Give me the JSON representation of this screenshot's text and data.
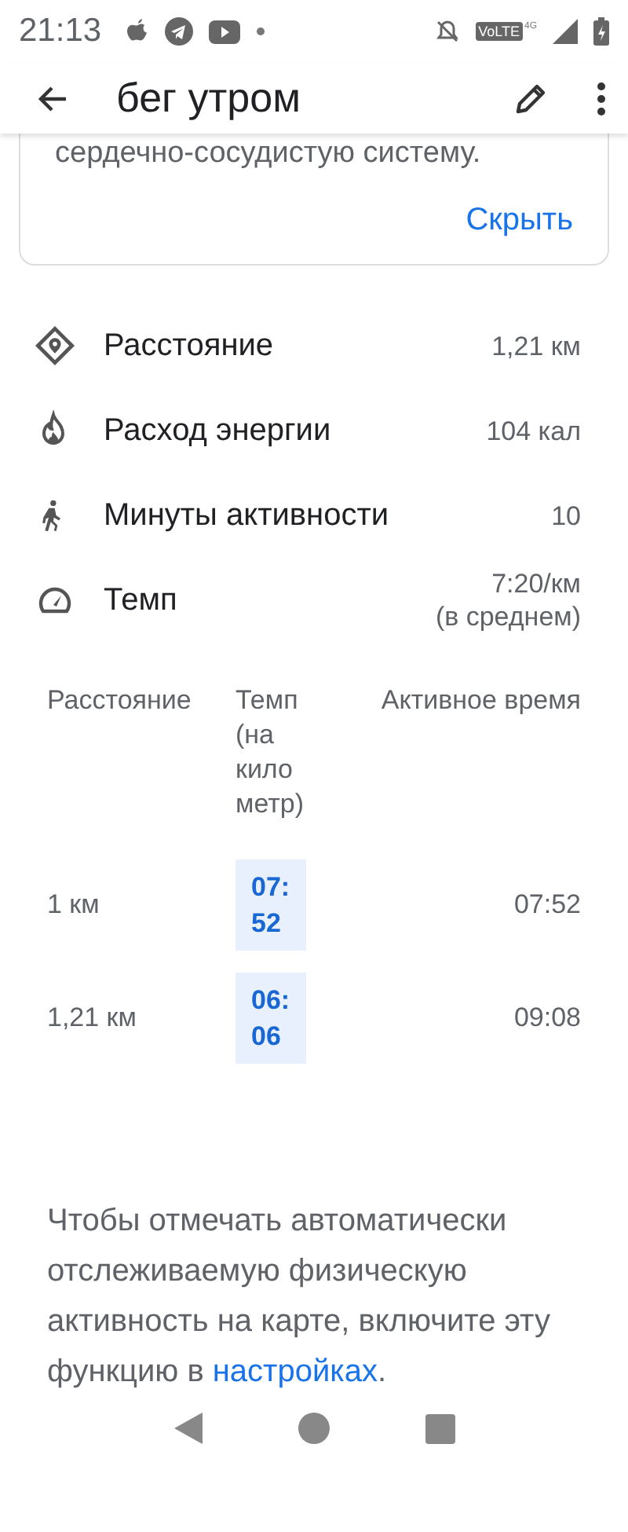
{
  "status_bar": {
    "time": "21:13",
    "network": "VoLTE",
    "network_type": "4G"
  },
  "app_bar": {
    "title": "бег утром"
  },
  "card": {
    "text": "сердечно-сосудистую систему.",
    "action": "Скрыть"
  },
  "stats": [
    {
      "kind": "distance",
      "label": "Расстояние",
      "value": "1,21 км"
    },
    {
      "kind": "energy",
      "label": "Расход энергии",
      "value": "104 кал"
    },
    {
      "kind": "active",
      "label": "Минуты активности",
      "value": "10"
    },
    {
      "kind": "pace",
      "label": "Темп",
      "value": "7:20/км",
      "note": "(в среднем)"
    }
  ],
  "table": {
    "columns": [
      "Расстояние",
      "Темп (на кило метр)",
      "Активное время"
    ],
    "rows": [
      {
        "distance": "1 км",
        "pace": "07:52",
        "time": "07:52"
      },
      {
        "distance": "1,21 км",
        "pace": "06:06",
        "time": "09:08"
      }
    ]
  },
  "note": {
    "text": "Чтобы отмечать автоматически отслеживаемую физическую активность на карте, включите эту функцию в ",
    "link": "настройках",
    "end": "."
  }
}
